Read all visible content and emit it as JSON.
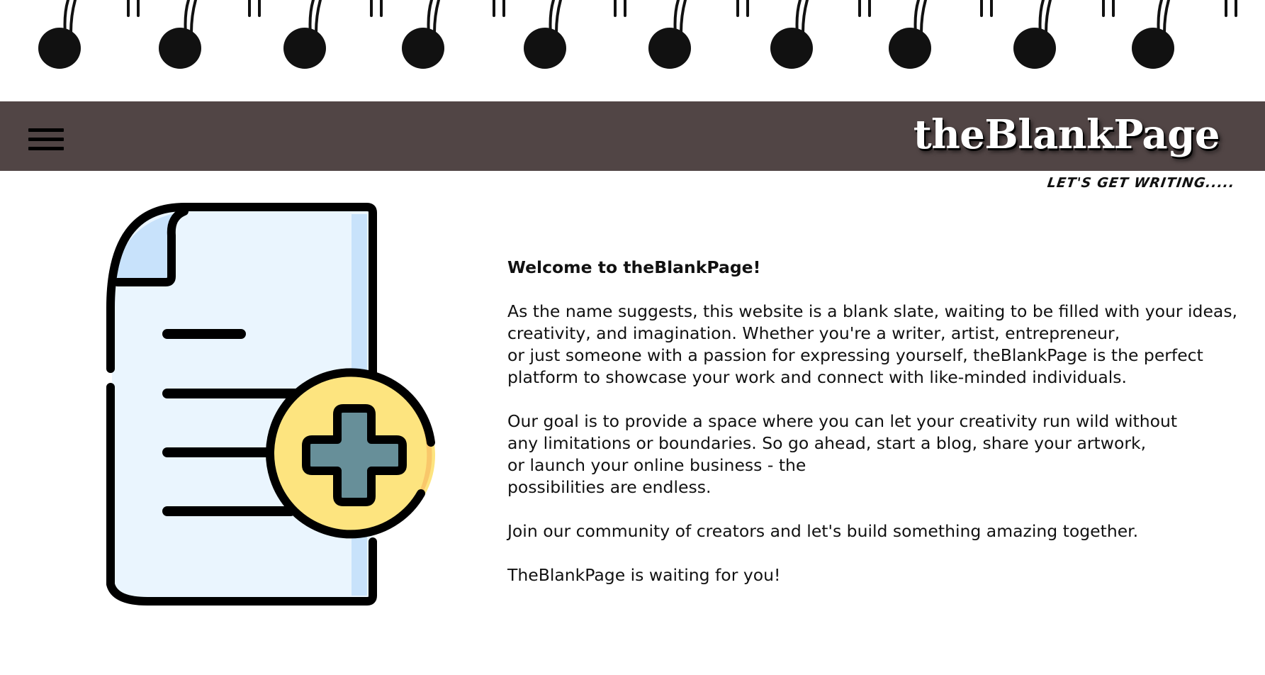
{
  "header": {
    "brand": "theBlankPage",
    "tagline": "LET'S GET WRITING.....",
    "menu_icon": "hamburger-menu-icon"
  },
  "illustration": {
    "icon": "add-document-icon"
  },
  "content": {
    "heading": "Welcome to theBlankPage!",
    "paragraph1": [
      "As the name suggests, this website is a blank slate, waiting to be filled with your ideas,",
      "creativity, and imagination. Whether you're a writer, artist, entrepreneur,",
      "or just someone with a passion for expressing yourself, theBlankPage is the perfect",
      "platform to showcase your work and connect with like-minded individuals."
    ],
    "paragraph2": [
      "Our goal is to provide a space where you can let your creativity run wild without",
      "any limitations or boundaries. So go ahead, start a blog, share your artwork,",
      "or launch your online business - the",
      "possibilities are endless."
    ],
    "paragraph3": "Join our community of creators and let's build something amazing together.",
    "paragraph4": "TheBlankPage is waiting for you!"
  },
  "colors": {
    "header_bg": "#514545",
    "doc_fill": "#EAF5FE",
    "doc_shade": "#C8E2FB",
    "badge_fill": "#FDE47F",
    "badge_shade": "#F9C76A",
    "plus_fill": "#678F99"
  }
}
